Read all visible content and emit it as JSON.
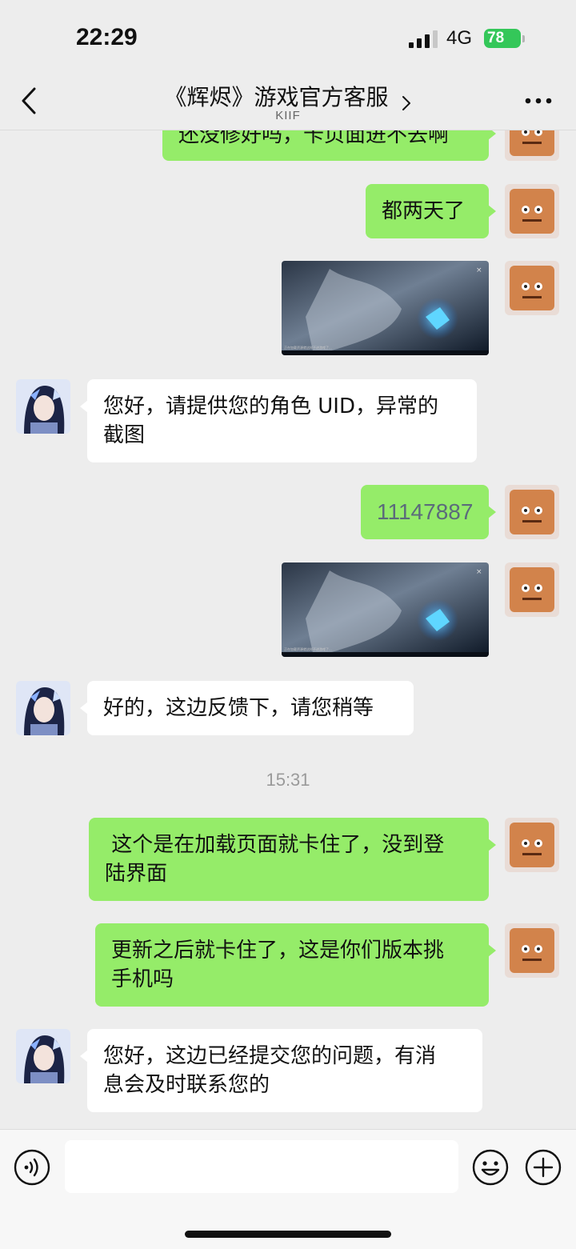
{
  "status_bar": {
    "time": "22:29",
    "network": "4G",
    "battery": "78"
  },
  "nav": {
    "back_icon": "chevron-left-icon",
    "title": "《辉烬》游戏官方客服",
    "subtitle": "KIIF",
    "more_icon": "more-dots-icon"
  },
  "messages": [
    {
      "sender": "me",
      "type": "text",
      "text": "还没修好吗，卡页面进不去啊"
    },
    {
      "sender": "me",
      "type": "text",
      "text": "都两天了"
    },
    {
      "sender": "me",
      "type": "image",
      "caption": "正在加载资源就这样不进游戏了..."
    },
    {
      "sender": "cs",
      "type": "text",
      "line1": "您好，请提供您的角色 UID，异常的",
      "line2": "截图"
    },
    {
      "sender": "me",
      "type": "text",
      "text": "11147887"
    },
    {
      "sender": "me",
      "type": "image",
      "caption": "正在加载资源就这样不进游戏了..."
    },
    {
      "sender": "cs",
      "type": "text",
      "text": "好的，这边反馈下，请您稍等"
    },
    {
      "type": "timestamp",
      "text": "15:31"
    },
    {
      "sender": "me",
      "type": "text",
      "line1": " 这个是在加载页面就卡住了，没到登",
      "line2": "陆界面"
    },
    {
      "sender": "me",
      "type": "text",
      "line1": "更新之后就卡住了，这是你们版本挑",
      "line2": "手机吗"
    },
    {
      "sender": "cs",
      "type": "text",
      "line1": "您好，这边已经提交您的问题，有消",
      "line2": "息会及时联系您的"
    }
  ],
  "input_bar": {
    "voice_icon": "voice-icon",
    "input_value": "",
    "emoji_icon": "emoji-icon",
    "plus_icon": "plus-icon"
  },
  "colors": {
    "my_bubble": "#95ec69",
    "cs_bubble": "#ffffff",
    "background": "#ededed",
    "battery": "#34c759"
  }
}
